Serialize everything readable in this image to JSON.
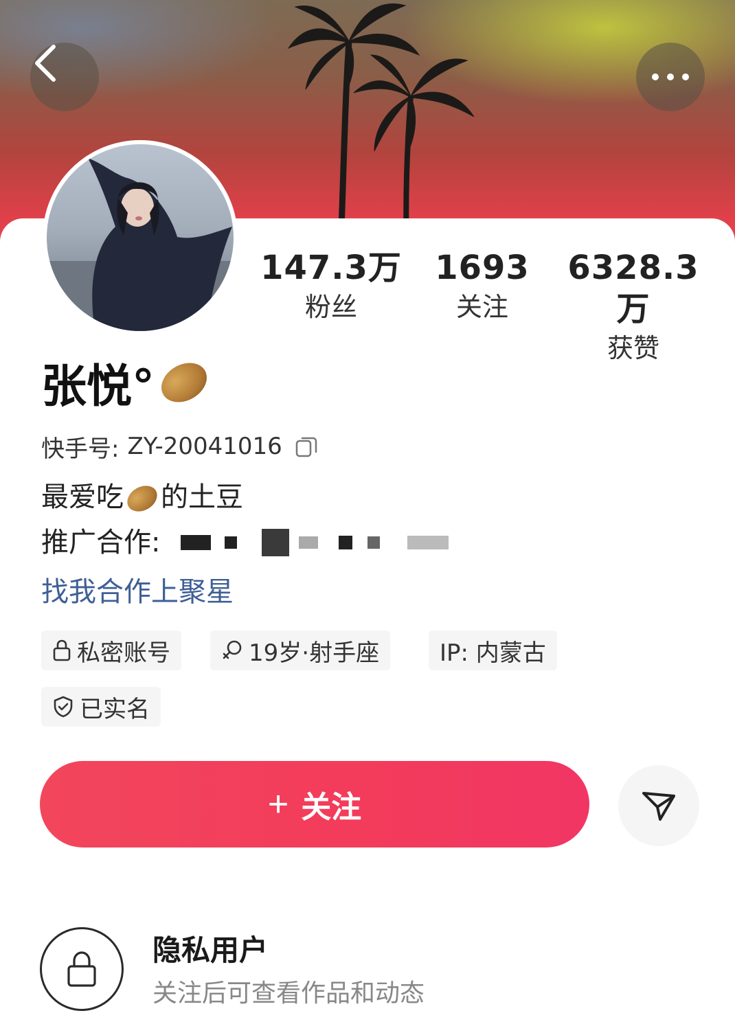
{
  "header": {
    "back_icon": "chevron-left-icon",
    "more_icon": "more-horizontal-icon"
  },
  "profile": {
    "stats": [
      {
        "value": "147.3万",
        "label": "粉丝"
      },
      {
        "value": "1693",
        "label": "关注"
      },
      {
        "value": "6328.3万",
        "label": "获赞"
      }
    ],
    "username": "张悦°",
    "kuaishou_id_label": "快手号:",
    "kuaishou_id": "ZY-20041016",
    "bio_before": "最爱吃",
    "bio_after": "的土豆",
    "promo_label": "推广合作:",
    "cooperation_link": "找我合作上聚星",
    "tags": {
      "private": "私密账号",
      "age": "19岁·射手座",
      "ip": "IP: 内蒙古",
      "verified": "已实名"
    },
    "follow_label": "关注",
    "share_icon": "send-icon"
  },
  "private_notice": {
    "title": "隐私用户",
    "description": "关注后可查看作品和动态"
  },
  "colors": {
    "accent": "#f33b5b",
    "link": "#3f5f95"
  }
}
